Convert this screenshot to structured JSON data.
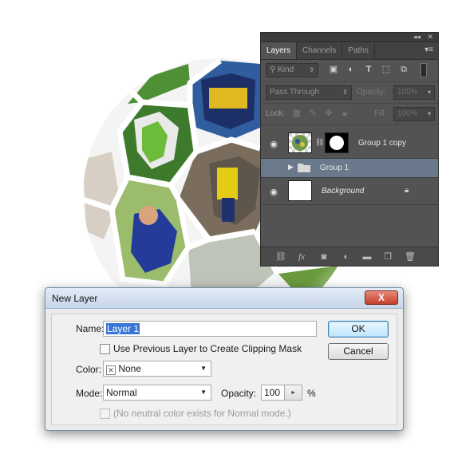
{
  "layers_panel": {
    "tabs": [
      {
        "label": "Layers",
        "active": true
      },
      {
        "label": "Channels",
        "active": false
      },
      {
        "label": "Paths",
        "active": false
      }
    ],
    "kind_filter": "Kind",
    "filter_icons": [
      "image-filter-icon",
      "adjustment-filter-icon",
      "type-filter-icon",
      "shape-filter-icon",
      "smart-object-filter-icon"
    ],
    "blend_mode": "Pass Through",
    "opacity_label": "Opacity:",
    "opacity_value": "100%",
    "lock_label": "Lock:",
    "fill_label": "Fill:",
    "fill_value": "100%",
    "layers": [
      {
        "name": "Group 1 copy",
        "visible": true,
        "selected": false
      },
      {
        "name": "Group 1",
        "visible": false,
        "selected": true
      },
      {
        "name": "Background",
        "visible": true,
        "selected": false,
        "locked": true
      }
    ],
    "bottom_icons": [
      "link-layers-icon",
      "fx-icon",
      "layer-mask-icon",
      "adjustment-layer-icon",
      "new-group-icon",
      "new-layer-icon",
      "delete-layer-icon"
    ]
  },
  "dialog": {
    "title": "New Layer",
    "close_label": "X",
    "name_label": "Name:",
    "name_value": "Layer 1",
    "clipping_mask_label": "Use Previous Layer to Create Clipping Mask",
    "clipping_mask_checked": false,
    "color_label": "Color:",
    "color_value": "None",
    "mode_label": "Mode:",
    "mode_value": "Normal",
    "opacity_label": "Opacity:",
    "opacity_value": "100",
    "opacity_unit": "%",
    "neutral_label": "(No neutral color exists for Normal mode.)",
    "ok_label": "OK",
    "cancel_label": "Cancel"
  },
  "colors": {
    "panel_bg": "#535353",
    "selection": "#6a7a8c",
    "dialog_bg": "#f0f0f0",
    "ok_accent": "#3c7fb1",
    "close_red": "#c2402c"
  }
}
